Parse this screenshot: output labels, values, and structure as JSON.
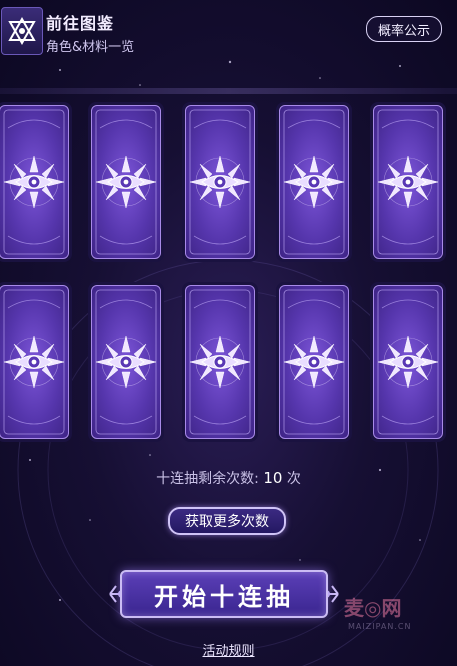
{
  "header": {
    "title": "前往图鉴",
    "subtitle": "角色&材料一览",
    "probability_button": "概率公示"
  },
  "cards": [
    {
      "id": 1
    },
    {
      "id": 2
    },
    {
      "id": 3
    },
    {
      "id": 4
    },
    {
      "id": 5
    },
    {
      "id": 6
    },
    {
      "id": 7
    },
    {
      "id": 8
    },
    {
      "id": 9
    },
    {
      "id": 10
    }
  ],
  "draw_info": {
    "label": "十连抽剩余次数:",
    "count": "10",
    "unit": "次"
  },
  "buttons": {
    "get_more": "获取更多次数",
    "start_ten_draw": "开始十连抽"
  },
  "footer": {
    "rules_link": "活动规则"
  },
  "watermark": {
    "text": "麦◎网",
    "url": "MAIZIPAN.CN"
  },
  "colors": {
    "background": "#160f33",
    "card_purple": "#5636ad",
    "card_border": "#a88ae8",
    "button_purple": "#3a2690"
  }
}
